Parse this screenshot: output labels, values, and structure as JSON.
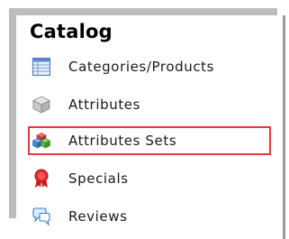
{
  "catalog_box": {
    "title": "Catalog",
    "items": [
      {
        "label": "Categories/Products",
        "icon": "categories-table-icon",
        "active": false
      },
      {
        "label": "Attributes",
        "icon": "attributes-cube-icon",
        "active": false
      },
      {
        "label": "Attributes Sets",
        "icon": "attribute-sets-cubes-icon",
        "active": true
      },
      {
        "label": "Specials",
        "icon": "specials-ribbon-icon",
        "active": false
      },
      {
        "label": "Reviews",
        "icon": "reviews-speech-bubble-icon",
        "active": false
      }
    ]
  },
  "colors": {
    "highlight_border": "#e03a3a",
    "frame_gray": "#bdbdbd",
    "text": "#1a1a1a"
  }
}
